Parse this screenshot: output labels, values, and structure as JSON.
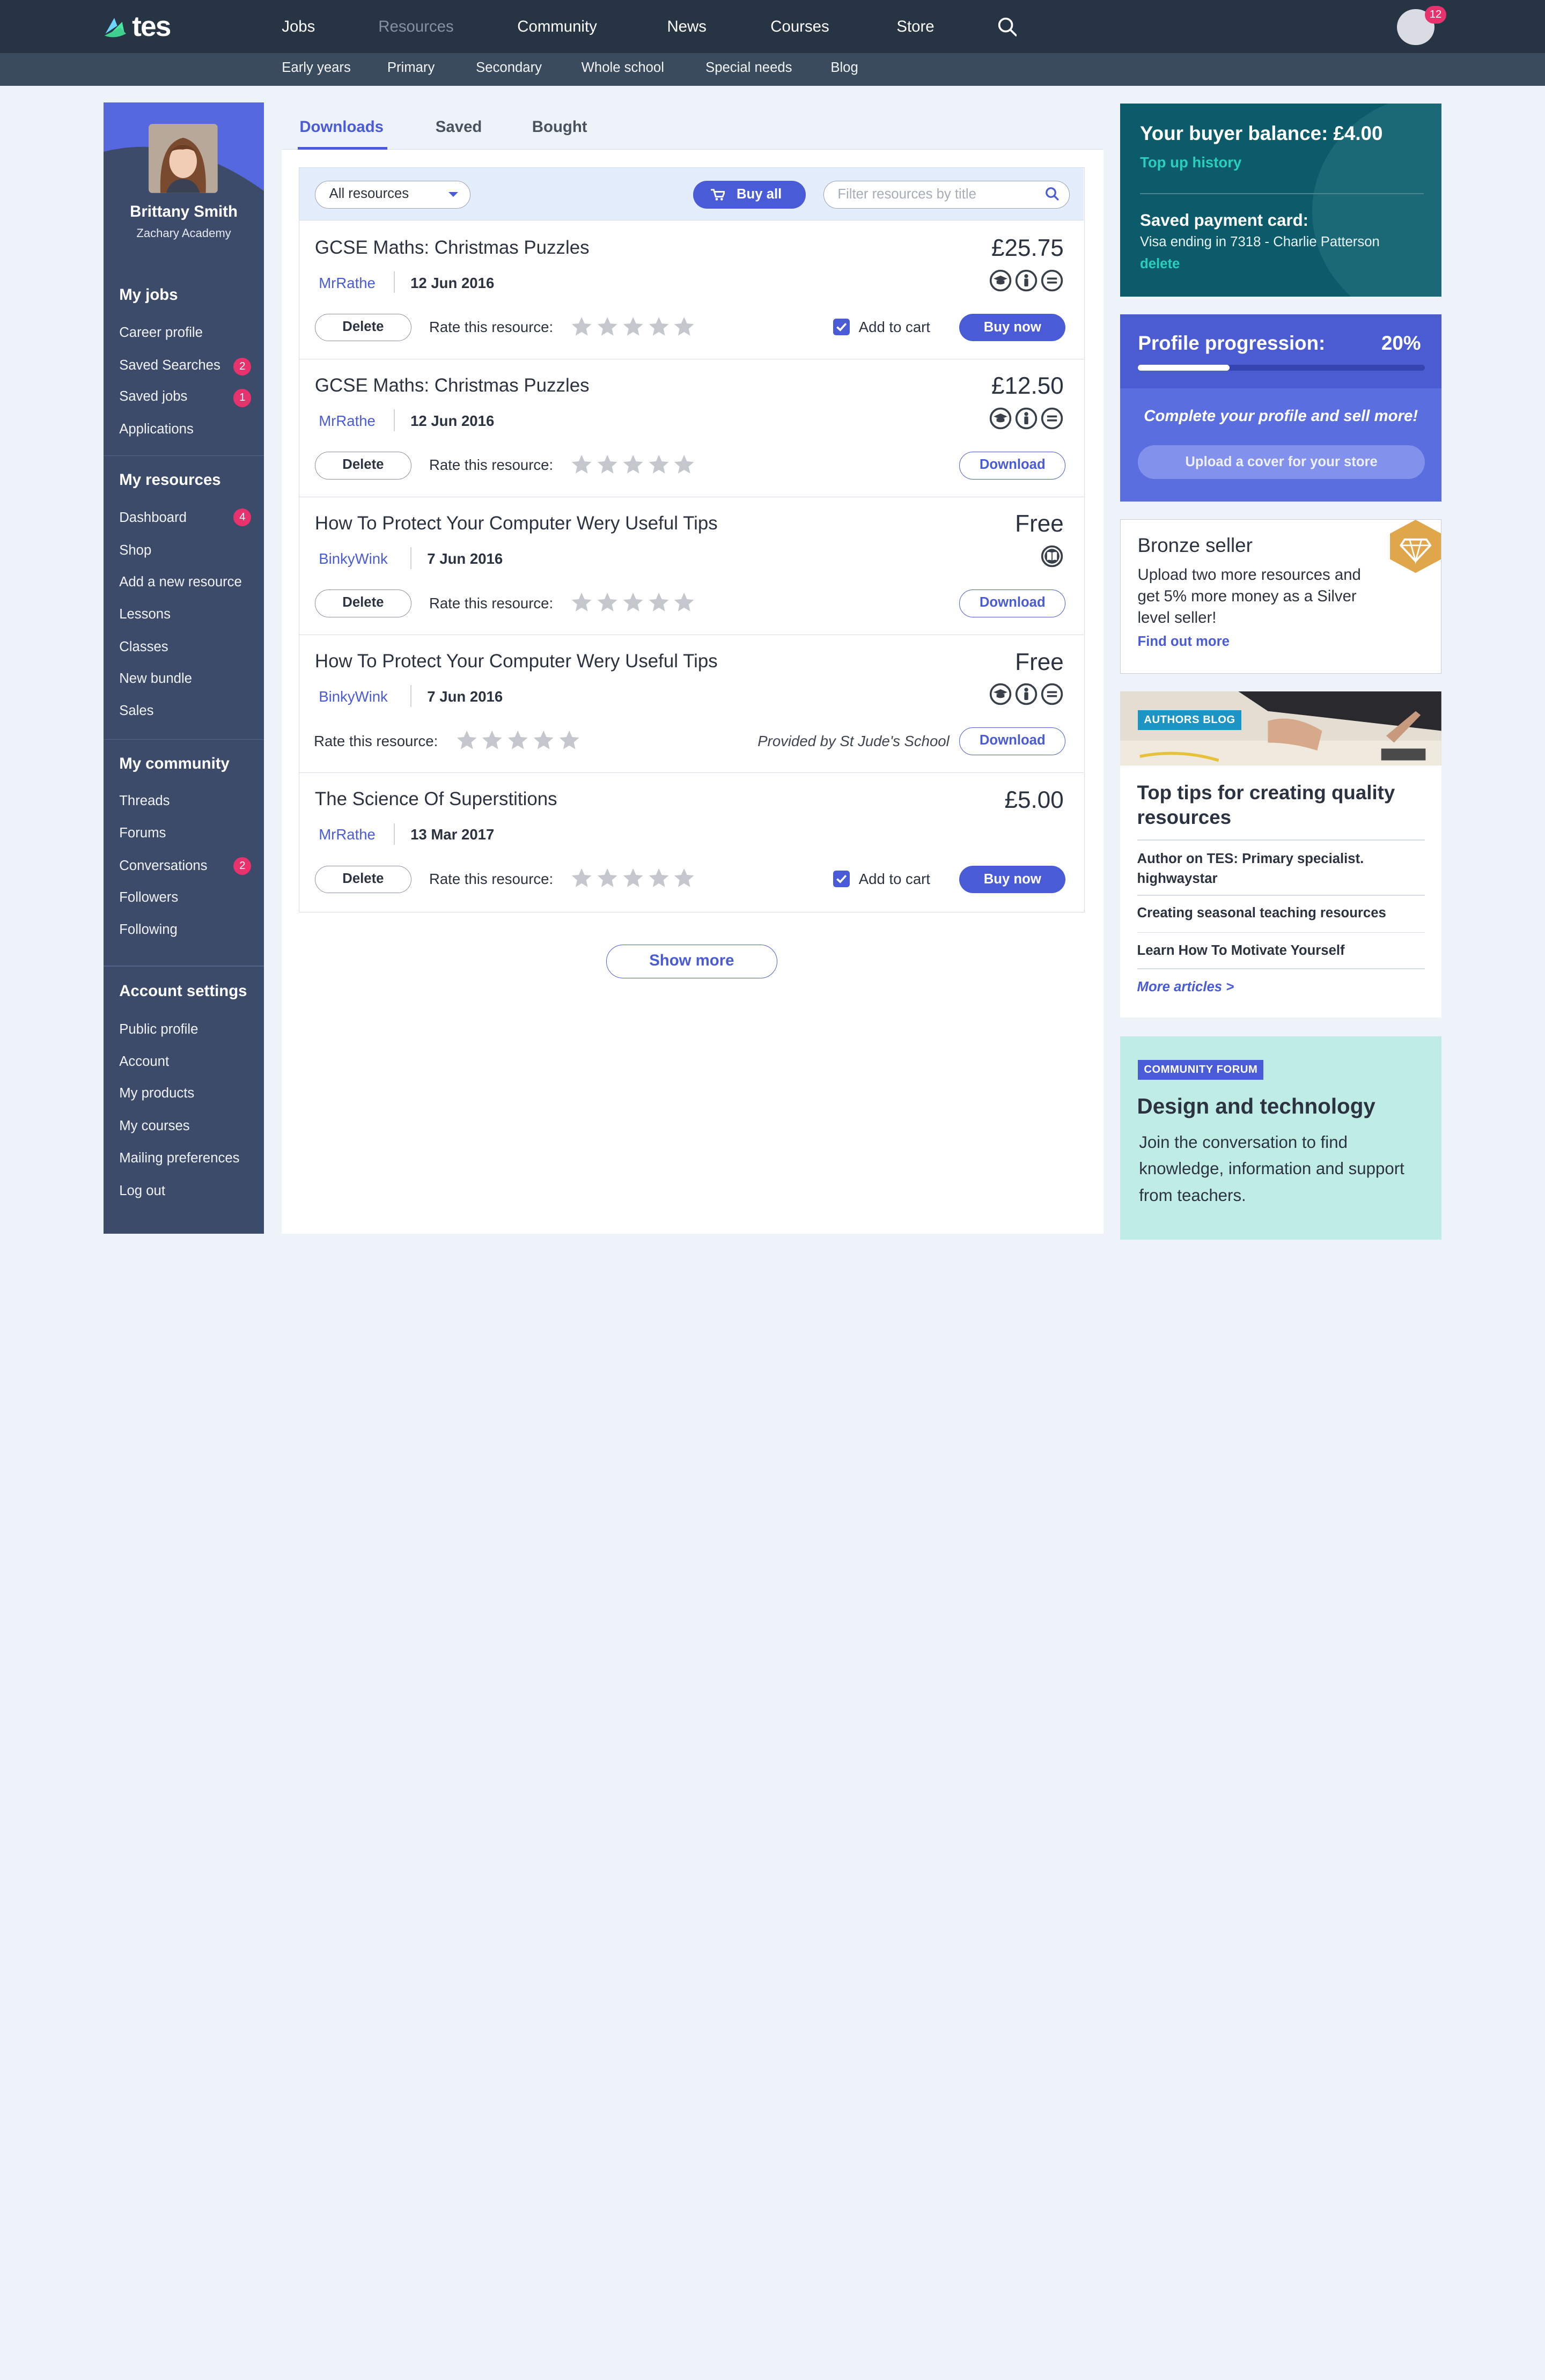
{
  "brand": {
    "logo_text": "tes"
  },
  "nav": {
    "items": [
      {
        "label": "Jobs",
        "active": false
      },
      {
        "label": "Resources",
        "active": true
      },
      {
        "label": "Community",
        "active": false
      },
      {
        "label": "News",
        "active": false
      },
      {
        "label": "Courses",
        "active": false
      },
      {
        "label": "Store",
        "active": false
      }
    ],
    "notification_count": "12"
  },
  "subnav": {
    "items": [
      "Early years",
      "Primary",
      "Secondary",
      "Whole school",
      "Special needs",
      "Blog"
    ]
  },
  "profile": {
    "name": "Brittany Smith",
    "school": "Zachary Academy"
  },
  "sidebar": {
    "sections": [
      {
        "heading": "My jobs",
        "items": [
          {
            "label": "Career profile"
          },
          {
            "label": "Saved Searches",
            "count": "2"
          },
          {
            "label": "Saved jobs",
            "count": "1"
          },
          {
            "label": "Applications"
          }
        ]
      },
      {
        "heading": "My resources",
        "items": [
          {
            "label": "Dashboard",
            "count": "4"
          },
          {
            "label": "Shop"
          },
          {
            "label": "Add a new resource"
          },
          {
            "label": "Lessons"
          },
          {
            "label": "Classes"
          },
          {
            "label": "New bundle"
          },
          {
            "label": "Sales"
          }
        ]
      },
      {
        "heading": "My community",
        "items": [
          {
            "label": "Threads"
          },
          {
            "label": "Forums"
          },
          {
            "label": "Conversations",
            "count": "2"
          },
          {
            "label": "Followers"
          },
          {
            "label": "Following"
          }
        ]
      },
      {
        "heading": "Account settings",
        "items": [
          {
            "label": "Public profile"
          },
          {
            "label": "Account"
          },
          {
            "label": "My products"
          },
          {
            "label": "My courses"
          },
          {
            "label": "Mailing preferences"
          },
          {
            "label": "Log out"
          }
        ]
      }
    ]
  },
  "tabs": [
    {
      "label": "Downloads",
      "active": true
    },
    {
      "label": "Saved",
      "active": false
    },
    {
      "label": "Bought",
      "active": false
    }
  ],
  "filters": {
    "type_select": "All resources",
    "buy_all_label": "Buy all",
    "search_placeholder": "Filter resources by title"
  },
  "labels": {
    "delete": "Delete",
    "rate": "Rate this resource:",
    "add_to_cart": "Add to cart",
    "buy_now": "Buy now",
    "download": "Download",
    "show_more": "Show more"
  },
  "resources": [
    {
      "title": "GCSE Maths: Christmas Puzzles",
      "price": "£25.75",
      "author": "MrRathe",
      "date": "12 Jun 2016",
      "licenses": [
        "cap-icon",
        "person-icon",
        "equal-icon"
      ],
      "action": "buy",
      "add_to_cart": true,
      "deletable": true,
      "provided_by": "",
      "rating": 0
    },
    {
      "title": "GCSE Maths: Christmas Puzzles",
      "price": "£12.50",
      "author": "MrRathe",
      "date": "12 Jun 2016",
      "licenses": [
        "cap-icon",
        "person-icon",
        "equal-icon"
      ],
      "action": "download",
      "add_to_cart": false,
      "deletable": true,
      "provided_by": "",
      "rating": 0
    },
    {
      "title": "How To Protect Your Computer Wery Useful Tips",
      "price": "Free",
      "author": "BinkyWink",
      "date": "7 Jun 2016",
      "licenses": [
        "book-icon"
      ],
      "action": "download",
      "add_to_cart": false,
      "deletable": true,
      "provided_by": "",
      "rating": 0
    },
    {
      "title": "How To Protect Your Computer Wery Useful Tips",
      "price": "Free",
      "author": "BinkyWink",
      "date": "7 Jun 2016",
      "licenses": [
        "cap-icon",
        "person-icon",
        "equal-icon"
      ],
      "action": "download",
      "add_to_cart": false,
      "deletable": false,
      "provided_by": "Provided by St Jude's School",
      "rating": 0
    },
    {
      "title": "The Science Of Superstitions",
      "price": "£5.00",
      "author": "MrRathe",
      "date": "13 Mar 2017",
      "licenses": [],
      "action": "buy",
      "add_to_cart": true,
      "deletable": true,
      "provided_by": "",
      "rating": 0
    }
  ],
  "balance": {
    "title": "Your buyer balance: £4.00",
    "top_up_link": "Top up history",
    "card_title": "Saved payment card:",
    "card_info": "Visa ending in 7318 - Charlie Patterson",
    "delete_link": "delete"
  },
  "progress": {
    "title": "Profile progression:",
    "percent_label": "20%",
    "fraction": 0.32,
    "message": "Complete your profile and sell more!",
    "button": "Upload a cover for your store"
  },
  "bronze": {
    "title": "Bronze seller",
    "text": "Upload two more resources and get 5% more money as a Silver level seller!",
    "link": "Find out more",
    "badge_icon": "diamond-icon"
  },
  "blog": {
    "tag": "AUTHORS BLOG",
    "title": "Top tips for creating quality resources",
    "items": [
      "Author on TES: Primary specialist. highwaystar",
      "Creating seasonal teaching resources",
      "Learn How To Motivate Yourself"
    ],
    "more": "More articles >"
  },
  "forum": {
    "tag": "COMMUNITY FORUM",
    "title": "Design and technology",
    "text": "Join the conversation to find knowledge, information and support from teachers."
  },
  "colors": {
    "accent": "#4a5bd8",
    "nav_bg": "#263444",
    "sidebar_bg": "#3d4b6b",
    "badge": "#e8326e",
    "teal": "#0b5b6b"
  }
}
